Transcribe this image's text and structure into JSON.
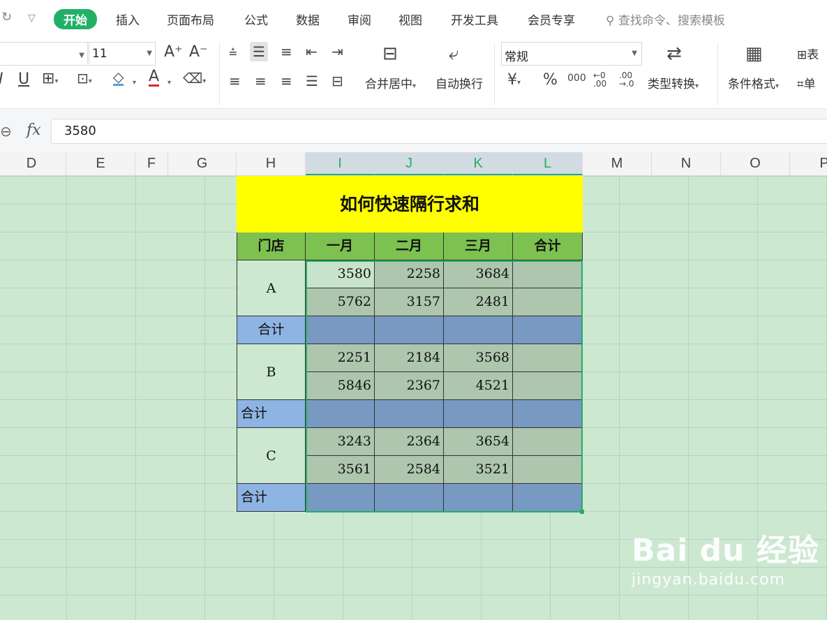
{
  "menu": {
    "redo_icon": "redo-icon",
    "dropdown_icon": "chevron-down-icon",
    "items": [
      {
        "label": "开始",
        "active": true
      },
      {
        "label": "插入"
      },
      {
        "label": "页面布局"
      },
      {
        "label": "公式"
      },
      {
        "label": "数据"
      },
      {
        "label": "审阅"
      },
      {
        "label": "视图"
      },
      {
        "label": "开发工具"
      },
      {
        "label": "会员专享"
      }
    ],
    "search_placeholder": "查找命令、搜索模板"
  },
  "toolbar": {
    "font_size": "11",
    "grow_font": "A⁺",
    "shrink_font": "A⁻",
    "merge_center": "合并居中",
    "wrap_text": "自动换行",
    "number_format": "常规",
    "currency": "¥",
    "percent": "%",
    "thousands": "000",
    "inc_decimal": "←0 .00",
    "dec_decimal": ".00 →.0",
    "type_convert": "类型转换",
    "conditional_format": "条件格式",
    "table_partial": "表",
    "cell_partial": "单"
  },
  "formula_bar": {
    "fx": "fx",
    "value": "3580"
  },
  "columns": [
    "D",
    "E",
    "F",
    "G",
    "H",
    "I",
    "J",
    "K",
    "L",
    "M",
    "N",
    "O",
    "P"
  ],
  "sheet": {
    "title": "如何快速隔行求和",
    "headers": [
      "门店",
      "一月",
      "二月",
      "三月",
      "合计"
    ],
    "stores": [
      {
        "name": "A",
        "rows": [
          [
            "3580",
            "2258",
            "3684"
          ],
          [
            "5762",
            "3157",
            "2481"
          ]
        ],
        "sum_label": "合计"
      },
      {
        "name": "B",
        "rows": [
          [
            "2251",
            "2184",
            "3568"
          ],
          [
            "5846",
            "2367",
            "4521"
          ]
        ],
        "sum_label": "合计"
      },
      {
        "name": "C",
        "rows": [
          [
            "3243",
            "2364",
            "3654"
          ],
          [
            "3561",
            "2584",
            "3521"
          ]
        ],
        "sum_label": "合计"
      }
    ]
  },
  "watermark": {
    "logo": "Bai du 经验",
    "url": "jingyan.baidu.com"
  },
  "colors": {
    "accent": "#22b066",
    "title_fill": "#ffff00",
    "header_fill": "#7dc150",
    "sum_label_fill": "#8db4e2",
    "sum_fill": "#7799c2"
  }
}
